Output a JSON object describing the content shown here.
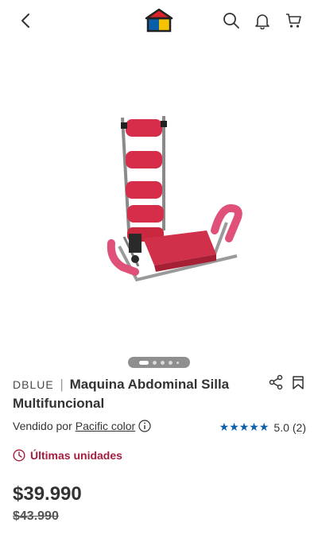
{
  "header": {
    "back_icon": "chevron-left-icon",
    "logo": "house-logo",
    "icons": [
      "search-icon",
      "bell-icon",
      "cart-icon"
    ]
  },
  "gallery": {
    "image": "abdominal-chair-photo",
    "pages": 5,
    "active_index": 0
  },
  "product": {
    "brand": "DBLUE",
    "separator": "|",
    "name": "Maquina Abdominal Silla Multifuncional"
  },
  "seller": {
    "prefix": "Vendido por",
    "name": "Pacific color"
  },
  "rating": {
    "stars": "★★★★★",
    "value": "5.0",
    "count": "(2)"
  },
  "stock": {
    "label": "Últimas unidades"
  },
  "pricing": {
    "price": "$39.990",
    "old_price": "$43.990"
  },
  "colors": {
    "accent_stock": "#a51d3f",
    "star_blue": "#0a5fa8"
  }
}
